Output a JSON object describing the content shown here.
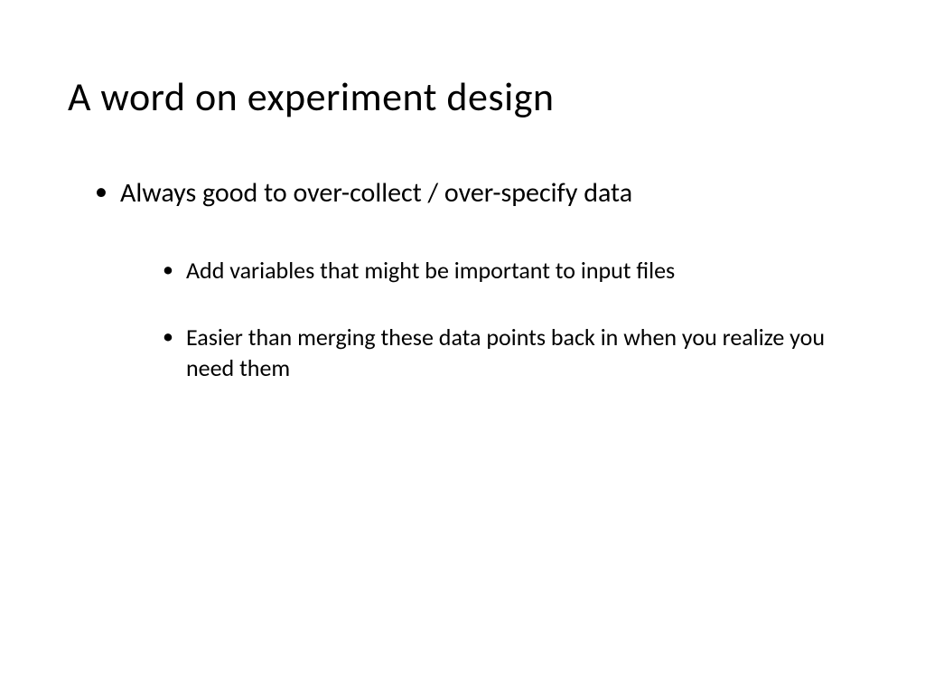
{
  "slide": {
    "title": "A word on experiment design",
    "bullets": {
      "b1": "Always good to over-collect / over-specify data",
      "b1_1": "Add variables that might be important to input files",
      "b1_2": "Easier than merging these data points back in when you realize you need them"
    }
  }
}
